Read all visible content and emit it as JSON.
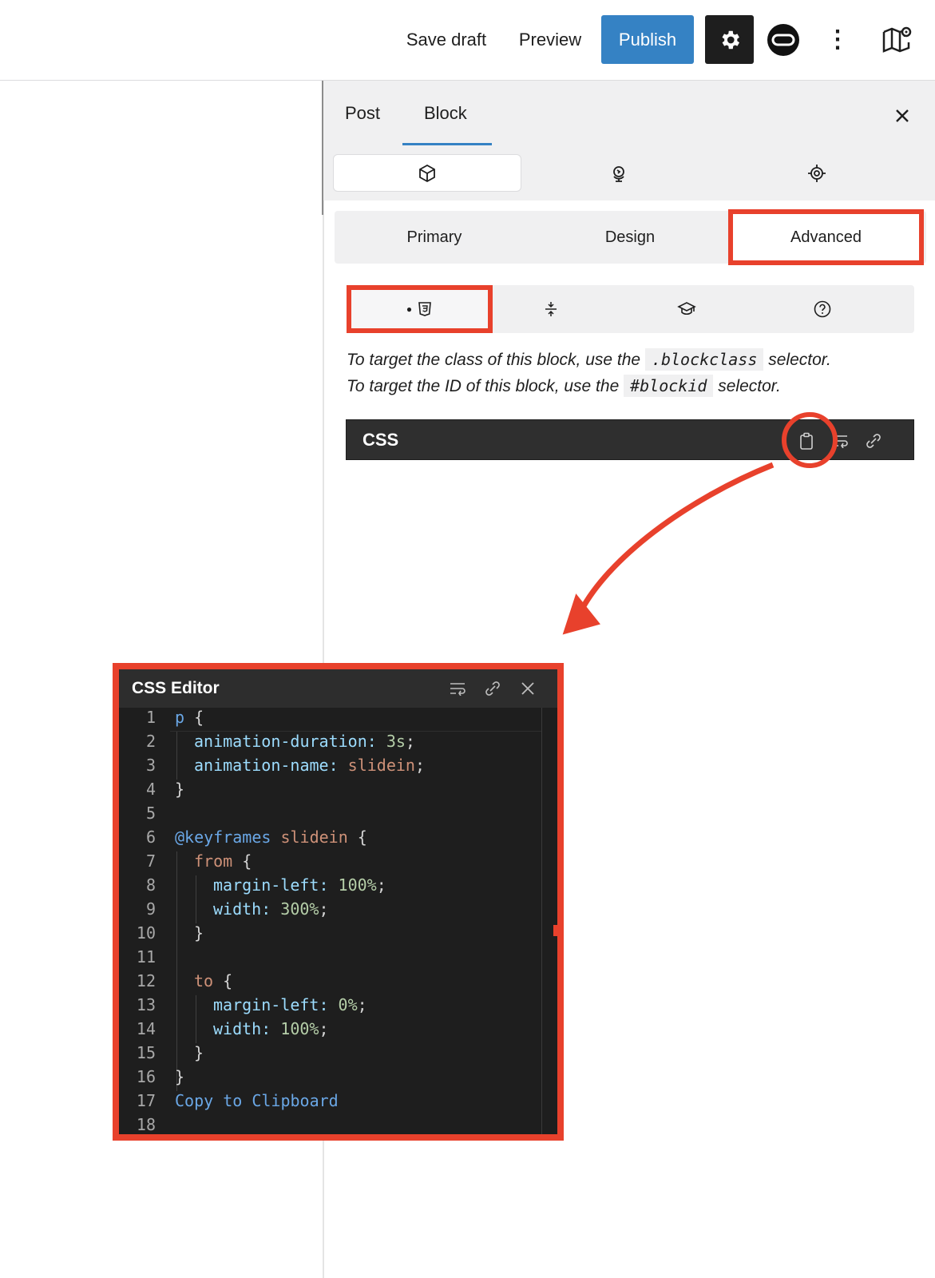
{
  "topbar": {
    "save_draft": "Save draft",
    "preview": "Preview",
    "publish": "Publish",
    "more": "⋮",
    "accent_color": "#3582c4"
  },
  "sidebar": {
    "tabs": [
      {
        "label": "Post"
      },
      {
        "label": "Block"
      }
    ],
    "active_tab": "Block",
    "block_icons": [
      "cube-icon",
      "globe-icon",
      "target-icon"
    ],
    "segments": [
      {
        "label": "Primary"
      },
      {
        "label": "Design"
      },
      {
        "label": "Advanced"
      }
    ],
    "active_segment": "Advanced",
    "sub_tabs": [
      "css3-icon",
      "compress-icon",
      "graduation-cap-icon",
      "help-icon"
    ],
    "help_text": {
      "line1_pre": "To target the class of this block, use the ",
      "line1_code": ".blockclass",
      "line1_post": " selector.",
      "line2_pre": "To target the ID of this block, use the ",
      "line2_code": "#blockid",
      "line2_post": " selector."
    },
    "css_bar": {
      "title": "CSS",
      "icons": [
        "clipboard-icon",
        "wrap-icon",
        "expand-icon"
      ]
    }
  },
  "editor": {
    "title": "CSS Editor",
    "icons": [
      "wrap-icon",
      "link-icon",
      "close-icon"
    ],
    "line_numbers": [
      "1",
      "2",
      "3",
      "4",
      "5",
      "6",
      "7",
      "8",
      "9",
      "10",
      "11",
      "12",
      "13",
      "14",
      "15",
      "16",
      "17",
      "18"
    ],
    "lines": {
      "l1_sel": "p",
      "l1_brace": " {",
      "l2_prop": "animation-duration:",
      "l2_val": " 3s",
      "l2_end": ";",
      "l3_prop": "animation-name:",
      "l3_val": " slidein",
      "l3_end": ";",
      "l4": "}",
      "l6_at": "@keyframes",
      "l6_name": " slidein",
      "l6_brace": " {",
      "l7_sel": "from",
      "l7_brace": " {",
      "l8_prop": "margin-left:",
      "l8_val": " 100%",
      "l8_end": ";",
      "l9_prop": "width:",
      "l9_val": " 300%",
      "l9_end": ";",
      "l10": "}",
      "l12_sel": "to",
      "l12_brace": " {",
      "l13_prop": "margin-left:",
      "l13_val": " 0%",
      "l13_end": ";",
      "l14_prop": "width:",
      "l14_val": " 100%",
      "l14_end": ";",
      "l15": "}",
      "l16": "}",
      "l17": "Copy to Clipboard"
    }
  },
  "highlight_color": "#e8412c"
}
